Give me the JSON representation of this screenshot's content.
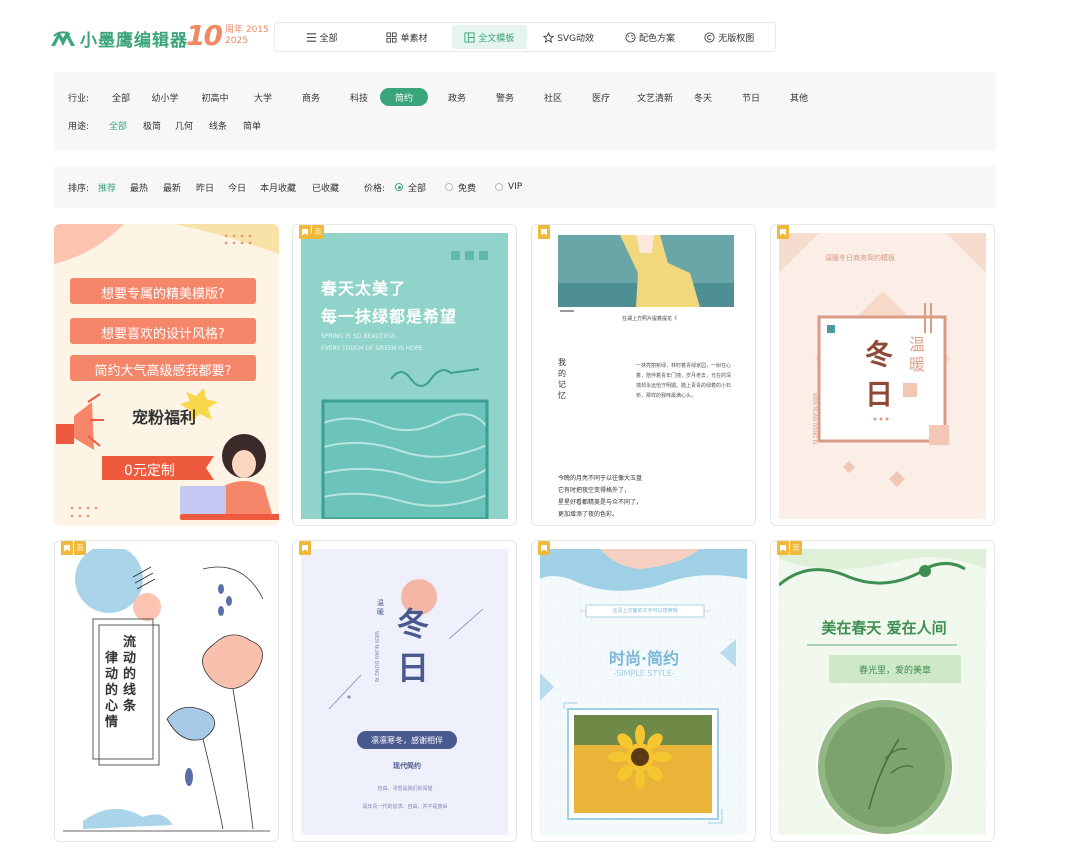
{
  "header": {
    "logo_text": "小墨鹰编辑器",
    "anniversary_number": "10",
    "anniversary_label1": "周年",
    "anniversary_year1": "2015",
    "anniversary_year2": "2025",
    "nav": [
      {
        "label": "全部",
        "icon": "list-icon"
      },
      {
        "label": "单素材",
        "icon": "grid-icon"
      },
      {
        "label": "全文模板",
        "icon": "template-icon",
        "active": true
      },
      {
        "label": "SVG动效",
        "icon": "star-icon"
      },
      {
        "label": "配色方案",
        "icon": "palette-icon"
      },
      {
        "label": "无版权图",
        "icon": "copyright-icon"
      }
    ]
  },
  "filters": {
    "industry_label": "行业:",
    "industry": [
      "全部",
      "幼小学",
      "初高中",
      "大学",
      "商务",
      "科技",
      "简约",
      "政务",
      "警务",
      "社区",
      "医疗",
      "文艺清新",
      "冬天",
      "节日",
      "其他"
    ],
    "industry_active": "简约",
    "usage_label": "用途:",
    "usage": [
      "全部",
      "极简",
      "几何",
      "线条",
      "简单"
    ],
    "usage_active": "全部"
  },
  "sort": {
    "label": "排序:",
    "items": [
      "推荐",
      "最热",
      "最新",
      "昨日",
      "今日",
      "本月收藏",
      "已收藏"
    ],
    "active": "推荐",
    "price_label": "价格:",
    "price_options": [
      "全部",
      "免费",
      "VIP"
    ],
    "price_active": "全部"
  },
  "cards": [
    {
      "texts": [
        "想要专属的精美模版?",
        "想要喜欢的设计风格?",
        "简约大气高级感我都要?",
        "宠粉福利",
        "0元定制"
      ]
    },
    {
      "badge": [
        "bm",
        "页"
      ],
      "texts": [
        "春天太美了",
        "每一抹绿都是希望",
        "SPRING IS SO BEAUTIFUL",
        "EVERY TOUCH OF GREEN IS HOPE"
      ]
    },
    {
      "badge": [
        "bm"
      ],
      "texts": [
        "在湖上方照片提着提花《",
        "我的记忆",
        "一抹亮丽新绿，林时着青绿家园，一树在心着，陪伴着青年门墙，岁月老去，光在的深墙却永远恰守明媚。踏上青青的绿着的小石桥，那样的我味最满心头。",
        "今晚的月亮不同于以往像大玉盘",
        "它有时把夜空变得格外了，",
        "星星好看都精美是与众不同了，",
        "更加增添了夜的色彩。"
      ]
    },
    {
      "badge": [
        "bm"
      ],
      "texts": [
        "温暖冬日商务简约模板",
        "冬",
        "日",
        "温",
        "暖",
        "WEN NUAN DONG RI"
      ]
    },
    {
      "badge": [
        "bm",
        "页"
      ],
      "texts": [
        "流动的线条",
        "律动的心情"
      ]
    },
    {
      "badge": [
        "bm"
      ],
      "texts": [
        "温暖",
        "冬",
        "日",
        "WEN NUAN DONG RI",
        "凛凛寒冬，感谢相伴",
        "现代简约",
        "自由、寻觅是我们的渴望",
        "是年青一代的追求、自由，并不是放纵"
      ]
    },
    {
      "badge": [
        "bm"
      ],
      "texts": [
        "在清上方面的文字可以替换哦",
        "时尚·简约",
        "-SIMPLE STYLE-"
      ]
    },
    {
      "badge": [
        "bm",
        "页"
      ],
      "texts": [
        "美在春天 爱在人间",
        "春光里，爱的美章"
      ]
    }
  ]
}
